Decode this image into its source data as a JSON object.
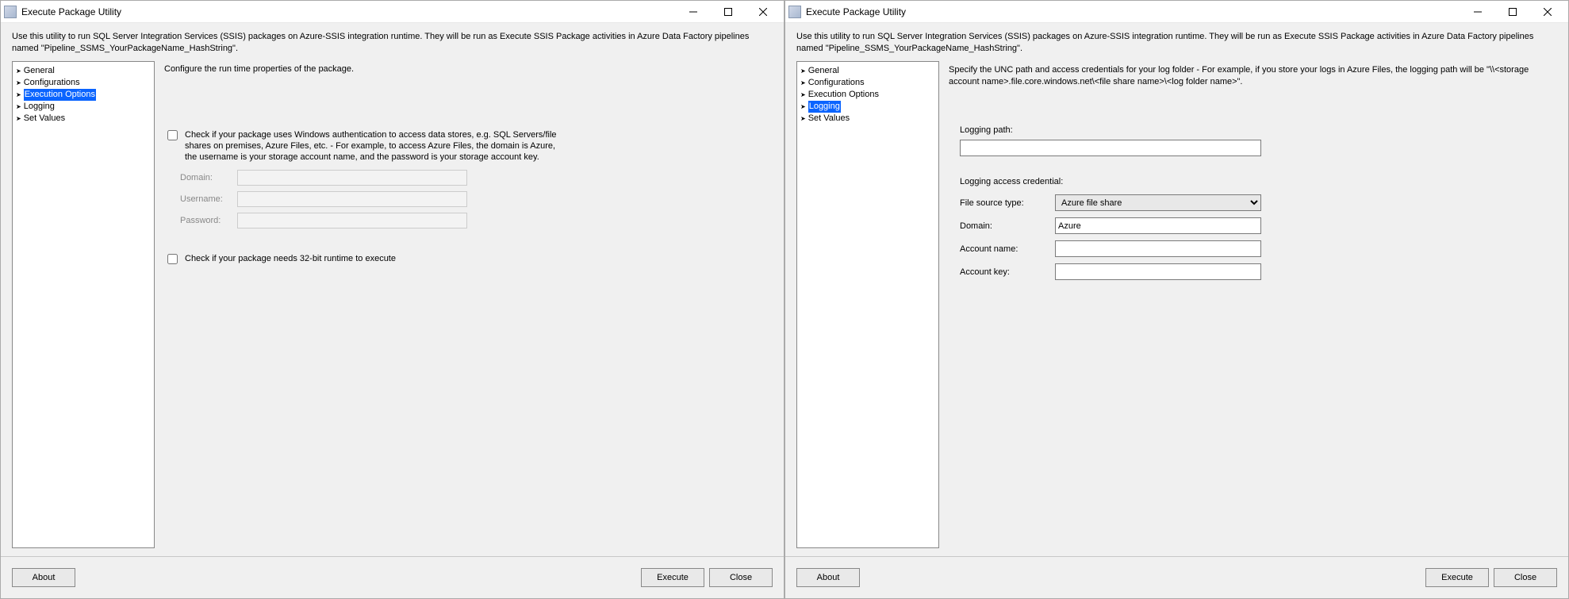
{
  "left": {
    "title": "Execute Package Utility",
    "intro": "Use this utility to run SQL Server Integration Services (SSIS) packages on Azure-SSIS integration runtime. They will be run as Execute SSIS Package activities in Azure Data Factory pipelines named \"Pipeline_SSMS_YourPackageName_HashString\".",
    "nav": {
      "general": "General",
      "configurations": "Configurations",
      "execution_options": "Execution Options",
      "logging": "Logging",
      "set_values": "Set Values"
    },
    "content": {
      "header": "Configure the run time properties of the package.",
      "auth_checkbox": "Check if your package uses Windows authentication to access data stores, e.g. SQL Servers/file shares on premises, Azure Files, etc. - For example, to access Azure Files, the domain is Azure, the username is your storage account name, and the password is your storage account key.",
      "domain_label": "Domain:",
      "username_label": "Username:",
      "password_label": "Password:",
      "bit32_checkbox": "Check if your package needs 32-bit runtime to execute"
    },
    "footer": {
      "about": "About",
      "execute": "Execute",
      "close": "Close"
    }
  },
  "right": {
    "title": "Execute Package Utility",
    "intro": "Use this utility to run SQL Server Integration Services (SSIS) packages on Azure-SSIS integration runtime. They will be run as Execute SSIS Package activities in Azure Data Factory pipelines named \"Pipeline_SSMS_YourPackageName_HashString\".",
    "nav": {
      "general": "General",
      "configurations": "Configurations",
      "execution_options": "Execution Options",
      "logging": "Logging",
      "set_values": "Set Values"
    },
    "content": {
      "header": "Specify the UNC path and access credentials for your log folder - For example, if you store your logs in Azure Files, the logging path will be \"\\\\<storage account name>.file.core.windows.net\\<file share name>\\<log folder name>\".",
      "logging_path_label": "Logging path:",
      "logging_path_value": "",
      "cred_label": "Logging access credential:",
      "file_source_label": "File source type:",
      "file_source_value": "Azure file share",
      "domain_label": "Domain:",
      "domain_value": "Azure",
      "account_name_label": "Account name:",
      "account_name_value": "",
      "account_key_label": "Account key:",
      "account_key_value": ""
    },
    "footer": {
      "about": "About",
      "execute": "Execute",
      "close": "Close"
    }
  }
}
